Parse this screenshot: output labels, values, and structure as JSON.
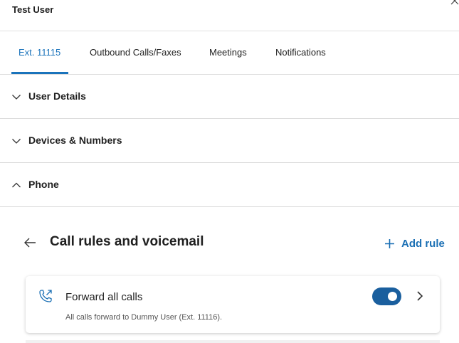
{
  "window": {
    "title": "Test User",
    "close_icon": "close-icon"
  },
  "tabs": [
    {
      "label": "Ext. 11115",
      "active": true
    },
    {
      "label": "Outbound Calls/Faxes",
      "active": false
    },
    {
      "label": "Meetings",
      "active": false
    },
    {
      "label": "Notifications",
      "active": false
    }
  ],
  "sections": [
    {
      "label": "User Details",
      "expanded": false,
      "icon": "chevron-down-icon"
    },
    {
      "label": "Devices & Numbers",
      "expanded": false,
      "icon": "chevron-down-icon"
    },
    {
      "label": "Phone",
      "expanded": true,
      "icon": "chevron-up-icon"
    }
  ],
  "call_rules": {
    "title": "Call rules and voicemail",
    "back_icon": "arrow-left-icon",
    "add_rule_label": "Add rule",
    "add_icon": "plus-icon",
    "rules": [
      {
        "title": "Forward all calls",
        "description": "All calls forward to Dummy User (Ext. 11116).",
        "icon": "phone-forward-icon",
        "enabled": true
      }
    ]
  },
  "colors": {
    "accent": "#1a73bb",
    "toggle": "#1a5f9e",
    "divider": "#dcdcdc"
  }
}
